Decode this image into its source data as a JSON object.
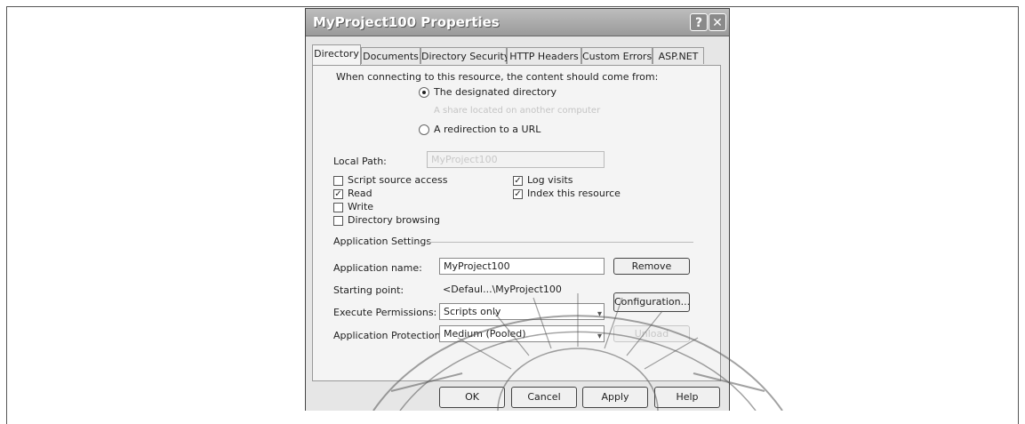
{
  "window": {
    "title": "MyProject100 Properties",
    "help_glyph": "?",
    "close_glyph": "✕"
  },
  "tabs": [
    {
      "label": "Directory"
    },
    {
      "label": "Documents"
    },
    {
      "label": "Directory Security"
    },
    {
      "label": "HTTP Headers"
    },
    {
      "label": "Custom Errors"
    },
    {
      "label": "ASP.NET"
    }
  ],
  "content_source": {
    "prompt": "When connecting to this resource, the content should come from:",
    "option_designated": "The designated directory",
    "option_share": "A share located on another computer",
    "option_redirect": "A redirection to a URL"
  },
  "local_path": {
    "label": "Local Path:",
    "value": "MyProject100"
  },
  "checkboxes": {
    "script_source": {
      "label": "Script source access",
      "checked": false
    },
    "read": {
      "label": "Read",
      "checked": true
    },
    "write": {
      "label": "Write",
      "checked": false
    },
    "directory_browsing": {
      "label": "Directory browsing",
      "checked": false
    },
    "log_visits": {
      "label": "Log visits",
      "checked": true
    },
    "index_resource": {
      "label": "Index this resource",
      "checked": true
    }
  },
  "check_mark": "✓",
  "app_settings": {
    "heading": "Application Settings",
    "name_label": "Application name:",
    "name_value": "MyProject100",
    "remove_label": "Remove",
    "starting_label": "Starting point:",
    "starting_value": "<Defaul...\\MyProject100",
    "configuration_label": "Configuration...",
    "exec_label": "Execute Permissions:",
    "exec_value": "Scripts only",
    "protection_label": "Application Protection:",
    "protection_value": "Medium (Pooled)",
    "unload_label": "Unload"
  },
  "footer": {
    "ok": "OK",
    "cancel": "Cancel",
    "apply": "Apply",
    "help": "Help"
  }
}
